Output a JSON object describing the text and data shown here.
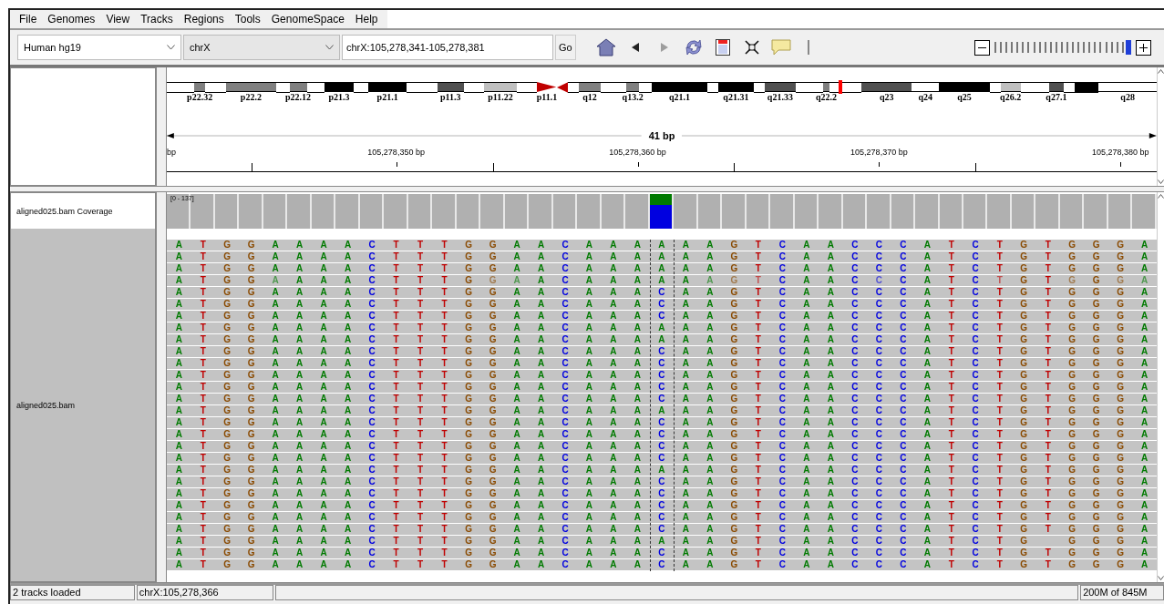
{
  "menu": [
    "File",
    "Genomes",
    "View",
    "Tracks",
    "Regions",
    "Tools",
    "GenomeSpace",
    "Help"
  ],
  "toolbar": {
    "genome": "Human hg19",
    "chromosome": "chrX",
    "locus": "chrX:105,278,341-105,278,381",
    "go": "Go",
    "tools": [
      {
        "kind": "home",
        "disabled": false
      },
      {
        "kind": "back",
        "disabled": false
      },
      {
        "kind": "forward",
        "disabled": true
      },
      {
        "kind": "refresh",
        "disabled": false
      },
      {
        "kind": "region",
        "disabled": false
      },
      {
        "kind": "fit",
        "disabled": false
      },
      {
        "kind": "popup",
        "disabled": false
      }
    ],
    "zoom": {
      "level": 1
    }
  },
  "ideogram": {
    "bands": [
      {
        "kind": "band",
        "color": "#ffffff"
      },
      {
        "kind": "band",
        "color": "#808080",
        "label": "p22.32"
      },
      {
        "kind": "band",
        "color": "#ffffff"
      },
      {
        "kind": "band",
        "color": "#808080",
        "label": "p22.2"
      },
      {
        "kind": "band",
        "color": "#ffffff"
      },
      {
        "kind": "band",
        "color": "#808080",
        "label": "p22.12"
      },
      {
        "kind": "band",
        "color": "#ffffff"
      },
      {
        "kind": "band",
        "color": "#000000",
        "label": "p21.3"
      },
      {
        "kind": "band",
        "color": "#ffffff"
      },
      {
        "kind": "band",
        "color": "#000000",
        "label": "p21.1"
      },
      {
        "kind": "band",
        "color": "#ffffff"
      },
      {
        "kind": "band",
        "color": "#505050",
        "label": "p11.3"
      },
      {
        "kind": "band",
        "color": "#ffffff"
      },
      {
        "kind": "band",
        "color": "#c0c0c0",
        "label": "p11.22"
      },
      {
        "kind": "band",
        "color": "#ffffff"
      },
      {
        "kind": "pcen",
        "color": "#c00000",
        "label": "p11.1"
      },
      {
        "kind": "qcen",
        "color": "#c00000"
      },
      {
        "kind": "band",
        "color": "#ffffff"
      },
      {
        "kind": "band",
        "color": "#808080",
        "label": "q12"
      },
      {
        "kind": "band",
        "color": "#ffffff"
      },
      {
        "kind": "band",
        "color": "#808080",
        "label": "q13.2"
      },
      {
        "kind": "band",
        "color": "#ffffff"
      },
      {
        "kind": "band",
        "color": "#000000",
        "label": "q21.1"
      },
      {
        "kind": "band",
        "color": "#ffffff"
      },
      {
        "kind": "band",
        "color": "#000000",
        "label": "q21.31"
      },
      {
        "kind": "band",
        "color": "#ffffff"
      },
      {
        "kind": "band",
        "color": "#505050",
        "label": "q21.33"
      },
      {
        "kind": "band",
        "color": "#ffffff"
      },
      {
        "kind": "band",
        "color": "#808080",
        "label": "q22.2"
      },
      {
        "kind": "band",
        "color": "#ffffff"
      },
      {
        "kind": "band",
        "color": "#505050",
        "label": "q23"
      },
      {
        "kind": "band",
        "color": "#ffffff",
        "label": "q24"
      },
      {
        "kind": "band",
        "color": "#000000",
        "label": "q25"
      },
      {
        "kind": "band",
        "color": "#ffffff"
      },
      {
        "kind": "band",
        "color": "#c0c0c0",
        "label": "q26.2"
      },
      {
        "kind": "band",
        "color": "#ffffff"
      },
      {
        "kind": "band",
        "color": "#505050",
        "label": "q27.1"
      },
      {
        "kind": "band",
        "color": "#ffffff"
      },
      {
        "kind": "band",
        "color": "#000000"
      },
      {
        "kind": "band",
        "color": "#ffffff",
        "label": "q28"
      }
    ]
  },
  "ruler": {
    "span": "41 bp",
    "labels": [
      "bp",
      "105,278,350 bp",
      "105,278,360 bp",
      "105,278,370 bp",
      "105,278,380 bp"
    ]
  },
  "tracks": [
    {
      "kind": "coverage",
      "name": "aligned025.bam Coverage",
      "range": "[0 - 137]"
    },
    {
      "kind": "alignments",
      "name": "aligned025.bam",
      "reads": [
        {
          "bases": "A T G G A A A A C T T T G G A A C A A A A A A G T C A A C C C A T C T G T G G G A"
        },
        {
          "bases": "A T G G A A A A C T T T G G A A C A A A A A A G T C A A C C C A T C T G T G G G A"
        },
        {
          "bases": "A T G G A A A A C T T T G G A A C A A A A A A G T C A A C C C A T C T G T G G G A"
        },
        {
          "bases": "A T G G A A A A C T T T G G A A C A A A A A A G T C A A C C C A T C T G T G G G A",
          "faint": [
            false,
            false,
            false,
            false,
            true,
            false,
            false,
            false,
            false,
            false,
            false,
            false,
            false,
            true,
            true,
            false,
            false,
            false,
            false,
            false,
            false,
            false,
            true,
            true,
            true,
            false,
            false,
            false,
            false,
            true,
            false,
            false,
            false,
            false,
            true,
            false,
            false,
            true,
            false,
            true,
            true
          ]
        },
        {
          "bases": "A T G G A A A A C T T T G G A A C A A A C A A G T C A A C C C A T C T G T G G G A"
        },
        {
          "bases": "A T G G A A A A C T T T G G A A C A A A C A A G T C A A C C C A T C T G T G G G A"
        },
        {
          "bases": "A T G G A A A A C T T T G G A A C A A A C A A G T C A A C C C A T C T G T G G G A"
        },
        {
          "bases": "A T G G A A A A C T T T G G A A C A A A A A A G T C A A C C C A T C T G T G G G A"
        },
        {
          "bases": "A T G G A A A A C T T T G G A A C A A A A A A G T C A A C C C A T C T G T G G G A"
        },
        {
          "bases": "A T G G A A A A C T T T G G A A C A A A C A A G T C A A C C C A T C T G T G G G A"
        },
        {
          "bases": "A T G G A A A A C T T T G G A A C A A A C A A G T C A A C C C A T C T G T G G G A"
        },
        {
          "bases": "A T G G A A A A C T T T G G A A C A A A C A A G T C A A C C C A T C T G T G G G A"
        },
        {
          "bases": "A T G G A A A A C T T T G G A A C A A A C A A G T C A A C C C A T C T G T G G G A"
        },
        {
          "bases": "A T G G A A A A C T T T G G A A C A A A C A A G T C A A C C C A T C T G T G G G A"
        },
        {
          "bases": "A T G G A A A A C T T T G G A A C A A A A A A G T C A A C C C A T C T G T G G G A"
        },
        {
          "bases": "A T G G A A A A C T T T G G A A C A A A C A A G T C A A C C C A T C T G T G G G A"
        },
        {
          "bases": "A T G G A A A A C T T T G G A A C A A A C A A G T C A A C C C A T C T G T G G G A"
        },
        {
          "bases": "A T G G A A A A C T T T G G A A C A A A C A A G T C A A C C C A T C T G T G G G A"
        },
        {
          "bases": "A T G G A A A A C T T T G G A A C A A A C A A G T C A A C C C A T C T G T G G G A"
        },
        {
          "bases": "A T G G A A A A C T T T G G A A C A A A A A A G T C A A C C C A T C T G T G G G A"
        },
        {
          "bases": "A T G G A A A A C T T T G G A A C A A A C A A G T C A A C C C A T C T G T G G G A"
        },
        {
          "bases": "A T G G A A A A C T T T G G A A C A A A C A A G T C A A C C C A T C T G T G G G A"
        },
        {
          "bases": "A T G G A A A A C T T T G G A A C A A A C A A G T C A A C C C A T C T G T G G G A"
        },
        {
          "bases": "A T G G A A A A C T T T G G A A C A A A C A A G T C A A C C C A T C T G T G G G A"
        },
        {
          "bases": "A T G G A A A A C T T T G G A A C A A A C A A G T C A A C C C A T C T G T G G G A"
        },
        {
          "bases": "A T G G A A A A C T T T G G A A C A A A A A A G T C A A C C C A T C T G  G G G A"
        },
        {
          "bases": "A T G G A A A A C T T T G G A A C A A A C A A G T C A A C C C A T C T G T G G G A"
        },
        {
          "bases": "A T G G A A A A C T T T G G A A C A A A C A A G T C A A C C C A T C T G T G G G A"
        }
      ]
    }
  ],
  "status_bar": {
    "message": "2 tracks loaded",
    "position": "chrX:105,278,366",
    "memory": "200M of 845M"
  }
}
